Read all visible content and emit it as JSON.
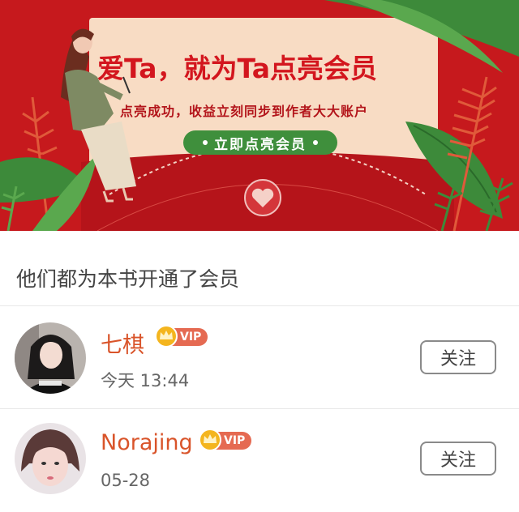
{
  "banner": {
    "title": "爱Ta，就为Ta点亮会员",
    "subtitle": "点亮成功，收益立刻同步到作者大大账户",
    "button_label": "立即点亮会员",
    "background_color": "#c6191d",
    "button_color": "#3f8f3c"
  },
  "section": {
    "title": "他们都为本书开通了会员"
  },
  "members": [
    {
      "name": "七棋",
      "vip_label": "VIP",
      "time": "今天 13:44",
      "follow_label": "关注"
    },
    {
      "name": "Norajing",
      "vip_label": "VIP",
      "time": "05-28",
      "follow_label": "关注"
    }
  ],
  "icons": {
    "crown": "crown-icon",
    "heart_seal": "heart-seal-icon"
  },
  "colors": {
    "name": "#d9542a",
    "vip_badge": "#e56a52"
  }
}
